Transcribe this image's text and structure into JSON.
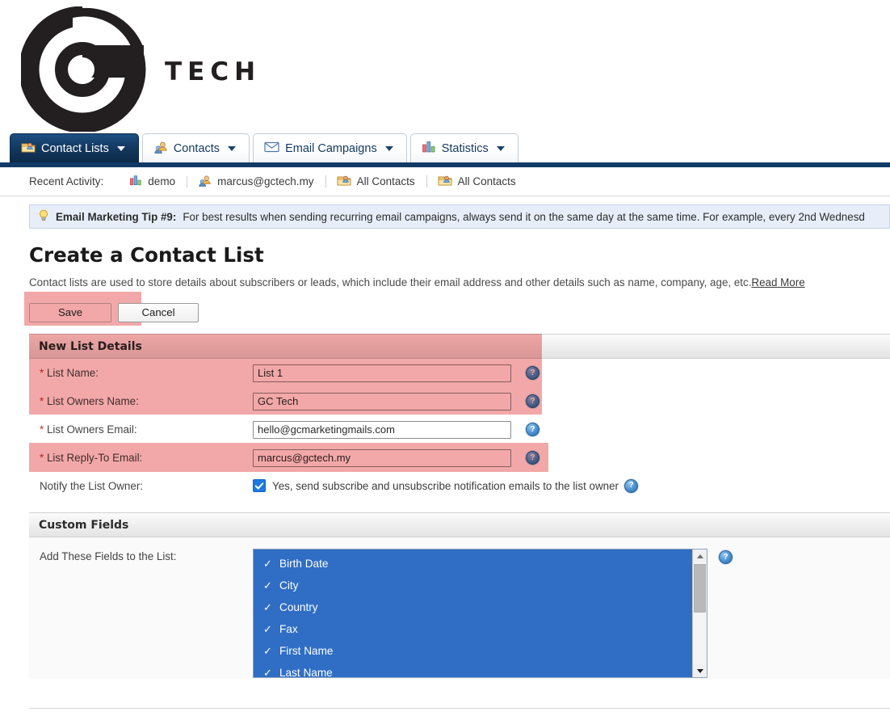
{
  "brand": {
    "logo_text": "TECH",
    "logo_icon": "gtech-g-logo"
  },
  "tabs": [
    {
      "label": "Contact Lists",
      "icon": "contact-list-icon",
      "active": true
    },
    {
      "label": "Contacts",
      "icon": "contacts-people-icon",
      "active": false
    },
    {
      "label": "Email Campaigns",
      "icon": "envelope-icon",
      "active": false
    },
    {
      "label": "Statistics",
      "icon": "bar-chart-icon",
      "active": false
    }
  ],
  "recent_activity": {
    "label": "Recent Activity:",
    "items": [
      {
        "label": "demo",
        "icon": "bar-chart-icon"
      },
      {
        "label": "marcus@gctech.my",
        "icon": "contacts-people-icon"
      },
      {
        "label": "All Contacts",
        "icon": "contact-list-icon"
      },
      {
        "label": "All Contacts",
        "icon": "contact-list-icon"
      }
    ]
  },
  "tip": {
    "icon": "lightbulb-icon",
    "title": "Email Marketing Tip #9:",
    "body": "For best results when sending recurring email campaigns, always send it on the same day at the same time. For example, every 2nd Wednesd"
  },
  "page": {
    "title": "Create a Contact List",
    "description": "Contact lists are used to store details about subscribers or leads, which include their email address and other details such as name, company, age, etc.",
    "read_more": "Read More"
  },
  "actions": {
    "save_label": "Save",
    "cancel_label": "Cancel"
  },
  "new_list_details": {
    "header": "New List Details",
    "fields": [
      {
        "label": "List Name:",
        "required": true,
        "value": "List 1",
        "help": "?",
        "highlighted": true
      },
      {
        "label": "List Owners Name:",
        "required": true,
        "value": "GC Tech",
        "help": "?",
        "highlighted": true
      },
      {
        "label": "List Owners Email:",
        "required": true,
        "value": "hello@gcmarketingmails.com",
        "help": "?",
        "highlighted": false
      },
      {
        "label": "List Reply-To Email:",
        "required": true,
        "value": "marcus@gctech.my",
        "help": "?",
        "highlighted": true
      }
    ],
    "notify": {
      "label": "Notify the List Owner:",
      "checkbox_checked": true,
      "checkbox_text": "Yes, send subscribe and unsubscribe notification emails to the list owner",
      "help": "?"
    }
  },
  "custom_fields": {
    "header": "Custom Fields",
    "label": "Add These Fields to the List:",
    "help": "?",
    "options": [
      {
        "label": "Birth Date",
        "selected": true
      },
      {
        "label": "City",
        "selected": true
      },
      {
        "label": "Country",
        "selected": true
      },
      {
        "label": "Fax",
        "selected": true
      },
      {
        "label": "First Name",
        "selected": true
      },
      {
        "label": "Last Name",
        "selected": true
      }
    ],
    "scrollbar": {
      "up_icon": "scroll-up-arrow",
      "down_icon": "scroll-down-arrow"
    }
  },
  "colors": {
    "highlight_pink": "#f2a8a8",
    "active_tab_blue": "#12365c",
    "listbox_blue": "#2f6ec4",
    "tip_background": "#e8eef9"
  }
}
